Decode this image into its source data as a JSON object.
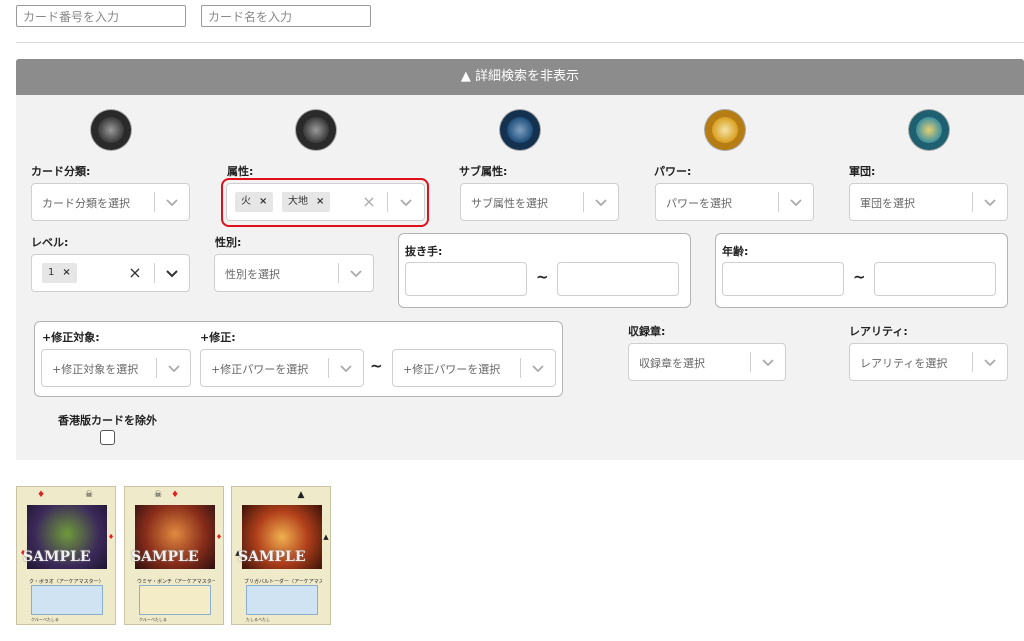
{
  "top_inputs": {
    "card_number_placeholder": "カード番号を入力",
    "card_name_placeholder": "カード名を入力"
  },
  "panel": {
    "toggle_label": "▲ 詳細検索を非表示"
  },
  "medal_colors": [
    "#3a3a3a",
    "#3a3a3a",
    "#1d4d7a",
    "#d9a020",
    "#3d8fa0"
  ],
  "fields": {
    "card_category": {
      "label": "カード分類:",
      "placeholder": "カード分類を選択"
    },
    "attribute": {
      "label": "属性:",
      "chips": [
        "火",
        "大地"
      ]
    },
    "sub_attribute": {
      "label": "サブ属性:",
      "placeholder": "サブ属性を選択"
    },
    "power": {
      "label": "パワー:",
      "placeholder": "パワーを選択"
    },
    "army": {
      "label": "軍団:",
      "placeholder": "軍団を選択"
    },
    "level": {
      "label": "レベル:",
      "chips": [
        "1"
      ]
    },
    "gender": {
      "label": "性別:",
      "placeholder": "性別を選択"
    },
    "draw_hand": {
      "label": "抜き手:",
      "tilde": "~"
    },
    "age": {
      "label": "年齢:",
      "tilde": "~"
    },
    "modifier_target": {
      "label": "+修正対象:",
      "placeholder": "+修正対象を選択"
    },
    "modifier": {
      "label": "+修正:",
      "placeholder_from": "+修正パワーを選択",
      "placeholder_to": "+修正パワーを選択",
      "tilde": "~"
    },
    "collection": {
      "label": "収録章:",
      "placeholder": "収録章を選択"
    },
    "rarity": {
      "label": "レアリティ:",
      "placeholder": "レアリティを選択"
    },
    "exclude_hk": {
      "label": "香港版カードを除外",
      "checked": false
    }
  },
  "cards": [
    {
      "watermark": "SAMPLE",
      "title": "ク・ボラオ〈アーケアマスター〉",
      "footer": "クルーベたしる",
      "art_color": "#3c2a5a"
    },
    {
      "watermark": "SAMPLE",
      "title": "ウミヤ・ボンチ〈アーケアマスター〉",
      "footer": "クルーベたしる",
      "art_color": "#8a2d1a"
    },
    {
      "watermark": "SAMPLE",
      "title": "ブリガバルトーダー〈アーケアマスター〉",
      "footer": "たしるベたし",
      "art_color": "#b2401b"
    }
  ]
}
